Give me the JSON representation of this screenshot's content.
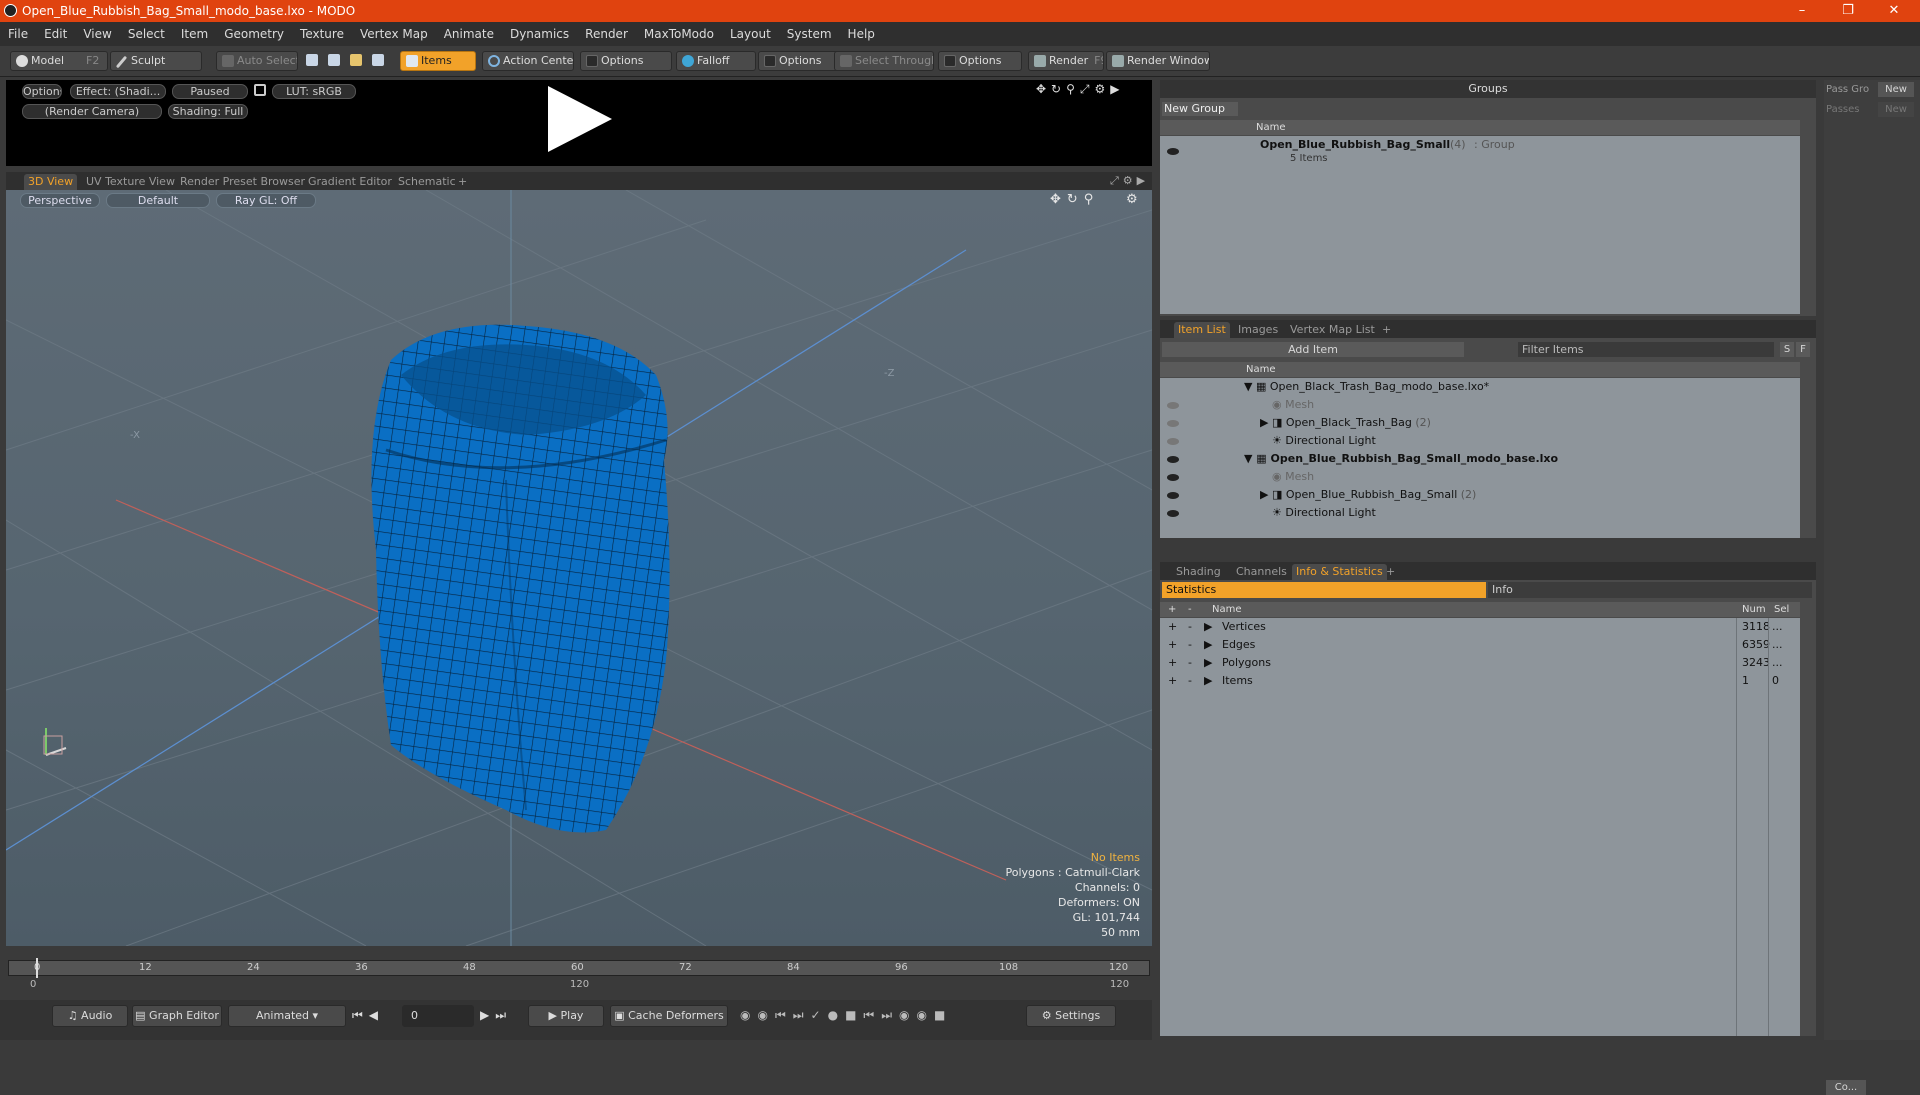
{
  "window": {
    "title": "Open_Blue_Rubbish_Bag_Small_modo_base.lxo - MODO"
  },
  "menu": [
    "File",
    "Edit",
    "View",
    "Select",
    "Item",
    "Geometry",
    "Texture",
    "Vertex Map",
    "Animate",
    "Dynamics",
    "Render",
    "MaxToModo",
    "Layout",
    "System",
    "Help"
  ],
  "toolbar": {
    "model": "Model",
    "model_key": "F2",
    "sculpt": "Sculpt",
    "auto_select": "Auto Select",
    "items": "Items",
    "action_center": "Action Center",
    "options1": "Options",
    "falloff": "Falloff",
    "options2": "Options",
    "select_through": "Select Through",
    "options3": "Options",
    "render": "Render",
    "render_key": "F9",
    "render_window": "Render Window"
  },
  "preview": {
    "options": "Options",
    "effect": "Effect: (Shadi...",
    "paused": "Paused",
    "lut": "LUT: sRGB",
    "camera": "(Render Camera)",
    "shading": "Shading: Full"
  },
  "viewport_tabs": [
    "3D View",
    "UV Texture View",
    "Render Preset Browser",
    "Gradient Editor",
    "Schematic",
    "+"
  ],
  "viewport": {
    "perspective": "Perspective",
    "default": "Default",
    "raygl": "Ray GL: Off",
    "axis_x": "-X",
    "axis_z": "-Z",
    "stats": {
      "no_items": "No Items",
      "polygons": "Polygons : Catmull-Clark",
      "channels": "Channels: 0",
      "deformers": "Deformers: ON",
      "gl": "GL: 101,744",
      "lens": "50 mm"
    },
    "mesh_color": "#0a6fc4"
  },
  "groups": {
    "title": "Groups",
    "new_group": "New Group",
    "col_name": "Name",
    "item_name": "Open_Blue_Rubbish_Bag_Small",
    "item_count": "(4)",
    "item_type": ": Group",
    "item_sub": "5 Items"
  },
  "pass": {
    "pass_group": "Pass Gro",
    "new1": "New",
    "passes": "Passes",
    "new2": "New",
    "co": "Co..."
  },
  "itemlist": {
    "tabs": [
      "Item List",
      "Images",
      "Vertex Map List",
      "+"
    ],
    "add_item": "Add Item",
    "filter": "Filter Items",
    "s": "S",
    "f": "F",
    "col_name": "Name",
    "rows": [
      {
        "label": "Open_Black_Trash_Bag_modo_base.lxo*",
        "count": ""
      },
      {
        "label": "Mesh",
        "count": ""
      },
      {
        "label": "Open_Black_Trash_Bag",
        "count": "(2)"
      },
      {
        "label": "Directional Light",
        "count": ""
      },
      {
        "label": "Open_Blue_Rubbish_Bag_Small_modo_base.lxo",
        "count": ""
      },
      {
        "label": "Mesh",
        "count": ""
      },
      {
        "label": "Open_Blue_Rubbish_Bag_Small",
        "count": "(2)"
      },
      {
        "label": "Directional Light",
        "count": ""
      }
    ]
  },
  "info": {
    "tabs": [
      "Shading",
      "Channels",
      "Info & Statistics",
      "+"
    ],
    "statistics": "Statistics",
    "info": "Info",
    "col_name": "Name",
    "col_num": "Num",
    "col_sel": "Sel",
    "rows": [
      {
        "plus": "+",
        "minus": "-",
        "name": "Vertices",
        "num": "3118",
        "sel": "..."
      },
      {
        "plus": "+",
        "minus": "-",
        "name": "Edges",
        "num": "6359",
        "sel": "..."
      },
      {
        "plus": "+",
        "minus": "-",
        "name": "Polygons",
        "num": "3243",
        "sel": "..."
      },
      {
        "plus": "+",
        "minus": "-",
        "name": "Items",
        "num": "1",
        "sel": "0"
      }
    ]
  },
  "timeline": {
    "ticks": [
      "0",
      "12",
      "24",
      "36",
      "48",
      "60",
      "72",
      "84",
      "96",
      "108",
      "120"
    ],
    "start": "0",
    "mid": "120",
    "end": "120"
  },
  "bottom": {
    "audio": "Audio",
    "graph_editor": "Graph Editor",
    "animated": "Animated",
    "frame": "0",
    "play": "Play",
    "cache": "Cache Deformers",
    "settings": "Settings"
  }
}
